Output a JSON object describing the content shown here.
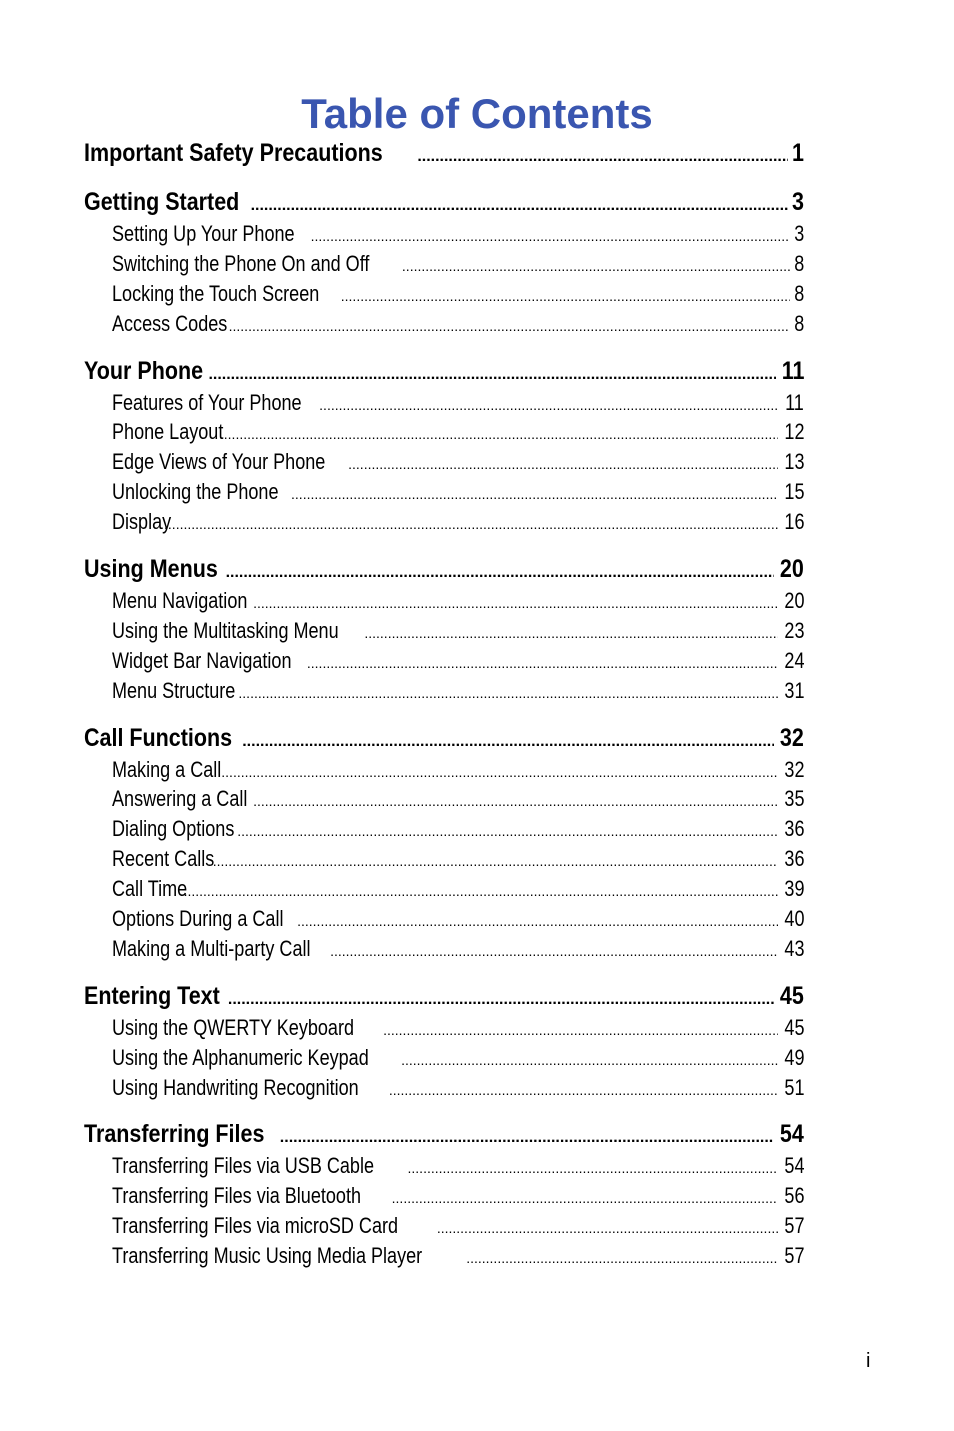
{
  "title": "Table of Contents",
  "sections": [
    {
      "title": "Important Safety Precautions",
      "page": "1",
      "entries": []
    },
    {
      "title": "Getting Started",
      "page": "3",
      "entries": [
        {
          "title": "Setting Up Your Phone",
          "page": "3"
        },
        {
          "title": "Switching the Phone On and Off",
          "page": "8"
        },
        {
          "title": "Locking the Touch Screen",
          "page": "8"
        },
        {
          "title": "Access Codes",
          "page": "8"
        }
      ]
    },
    {
      "title": "Your Phone",
      "page": "11",
      "entries": [
        {
          "title": "Features of Your Phone",
          "page": "11"
        },
        {
          "title": "Phone Layout",
          "page": "12"
        },
        {
          "title": "Edge Views of Your Phone",
          "page": "13"
        },
        {
          "title": "Unlocking the Phone",
          "page": "15"
        },
        {
          "title": "Display",
          "page": "16"
        }
      ]
    },
    {
      "title": "Using Menus",
      "page": "20",
      "entries": [
        {
          "title": "Menu Navigation",
          "page": "20"
        },
        {
          "title": "Using the Multitasking Menu",
          "page": "23"
        },
        {
          "title": "Widget Bar Navigation",
          "page": "24"
        },
        {
          "title": "Menu Structure",
          "page": "31"
        }
      ]
    },
    {
      "title": "Call Functions",
      "page": "32",
      "entries": [
        {
          "title": "Making a Call",
          "page": "32"
        },
        {
          "title": "Answering a Call",
          "page": "35"
        },
        {
          "title": "Dialing Options",
          "page": "36"
        },
        {
          "title": "Recent Calls",
          "page": "36"
        },
        {
          "title": "Call Time",
          "page": "39"
        },
        {
          "title": "Options During a Call",
          "page": "40"
        },
        {
          "title": "Making a Multi-party Call",
          "page": "43"
        }
      ]
    },
    {
      "title": "Entering Text",
      "page": "45",
      "entries": [
        {
          "title": "Using the QWERTY Keyboard",
          "page": "45"
        },
        {
          "title": "Using the Alphanumeric Keypad",
          "page": "49"
        },
        {
          "title": "Using Handwriting Recognition",
          "page": "51"
        }
      ]
    },
    {
      "title": "Transferring Files",
      "page": "54",
      "entries": [
        {
          "title": "Transferring Files via USB Cable",
          "page": "54"
        },
        {
          "title": "Transferring Files via Bluetooth",
          "page": "56"
        },
        {
          "title": "Transferring Files via microSD Card",
          "page": "57"
        },
        {
          "title": "Transferring Music Using Media Player",
          "page": "57"
        }
      ]
    }
  ],
  "footer": {
    "page_number": "i"
  },
  "colors": {
    "title": "#3a56b0",
    "text": "#000000"
  }
}
